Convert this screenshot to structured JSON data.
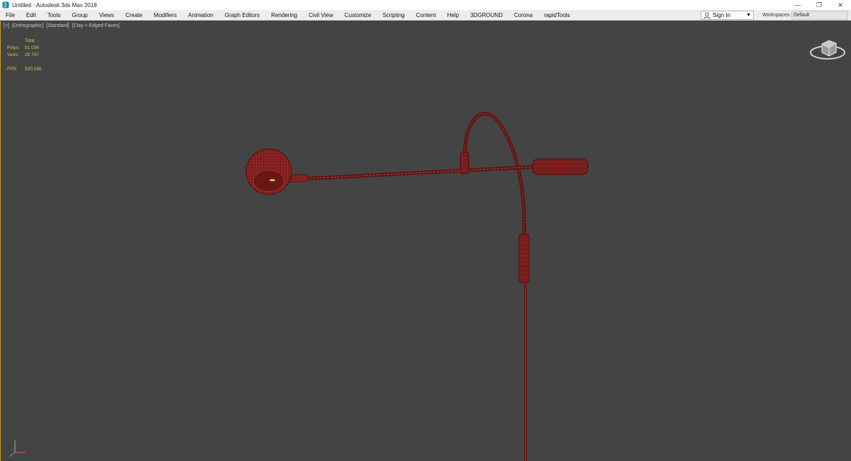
{
  "window": {
    "title": "Untitled - Autodesk 3ds Max 2018",
    "controls": {
      "minimize": "—",
      "restore": "❐",
      "close": "✕"
    }
  },
  "menu": {
    "items": [
      "File",
      "Edit",
      "Tools",
      "Group",
      "Views",
      "Create",
      "Modifiers",
      "Animation",
      "Graph Editors",
      "Rendering",
      "Civil View",
      "Customize",
      "Scripting",
      "Content",
      "Help",
      "3DGROUND",
      "Corona",
      "rapidTools"
    ],
    "sign_in": "Sign In",
    "workspaces_label": "Workspaces:",
    "workspaces_value": "Default"
  },
  "viewport": {
    "label_plus": "[+]",
    "label_view": "[Orthographic]",
    "label_shading": "[Standard]",
    "label_mode": "[Clay + Edged Faces]",
    "stats": {
      "header": "Total",
      "polys_label": "Polys:",
      "polys_value": "51 036",
      "verts_label": "Verts:",
      "verts_value": "25 747",
      "fps_label": "FPS:",
      "fps_value": "520,156"
    }
  },
  "colors": {
    "viewport_bg": "#444444",
    "model_fill": "#7a1d1d",
    "wire": "#c23a3a",
    "stats_text": "#dcc34a",
    "active_border": "#c9a227"
  },
  "icons": {
    "app": "3ds-max-icon",
    "user": "user-icon",
    "viewcube": "viewcube-icon",
    "axis": "axis-tripod-icon"
  }
}
